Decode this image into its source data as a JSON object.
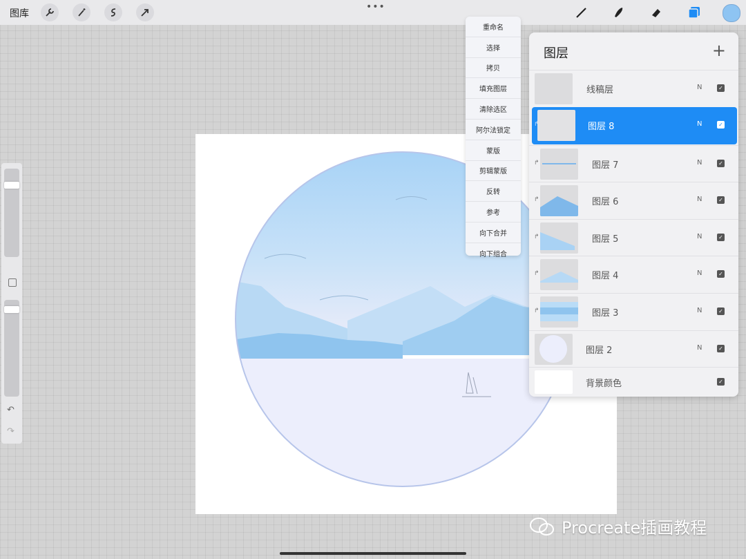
{
  "topbar": {
    "gallery_label": "图库",
    "tools_left": [
      "wrench-icon",
      "magic-wand-icon",
      "selection-icon",
      "transform-arrow-icon"
    ],
    "tools_right": [
      "brush-icon",
      "smudge-icon",
      "eraser-icon",
      "layers-icon"
    ],
    "more_label": "•••",
    "current_color": "#8ec4f2"
  },
  "context_menu": {
    "items": [
      "重命名",
      "选择",
      "拷贝",
      "填充图层",
      "清除选区",
      "阿尔法锁定",
      "蒙版",
      "剪辑蒙版",
      "反转",
      "参考",
      "向下合并",
      "向下组合"
    ]
  },
  "layers_panel": {
    "title": "图层",
    "add_label": "+",
    "layers": [
      {
        "name": "线稿层",
        "blend": "N",
        "visible": true,
        "selected": false,
        "clipped": false
      },
      {
        "name": "图层 8",
        "blend": "N",
        "visible": true,
        "selected": true,
        "clipped": true
      },
      {
        "name": "图层 7",
        "blend": "N",
        "visible": true,
        "selected": false,
        "clipped": true
      },
      {
        "name": "图层 6",
        "blend": "N",
        "visible": true,
        "selected": false,
        "clipped": true
      },
      {
        "name": "图层 5",
        "blend": "N",
        "visible": true,
        "selected": false,
        "clipped": true
      },
      {
        "name": "图层 4",
        "blend": "N",
        "visible": true,
        "selected": false,
        "clipped": true
      },
      {
        "name": "图层 3",
        "blend": "N",
        "visible": true,
        "selected": false,
        "clipped": true
      },
      {
        "name": "图层 2",
        "blend": "N",
        "visible": true,
        "selected": false,
        "clipped": false
      },
      {
        "name": "背景颜色",
        "blend": "",
        "visible": true,
        "selected": false,
        "clipped": false
      }
    ]
  },
  "watermark": {
    "text": "Procreate插画教程"
  },
  "colors": {
    "accent": "#1e8cf5",
    "sky": "#a9d3f5",
    "water": "#eceefc",
    "mountain": "#8fc4ee"
  }
}
